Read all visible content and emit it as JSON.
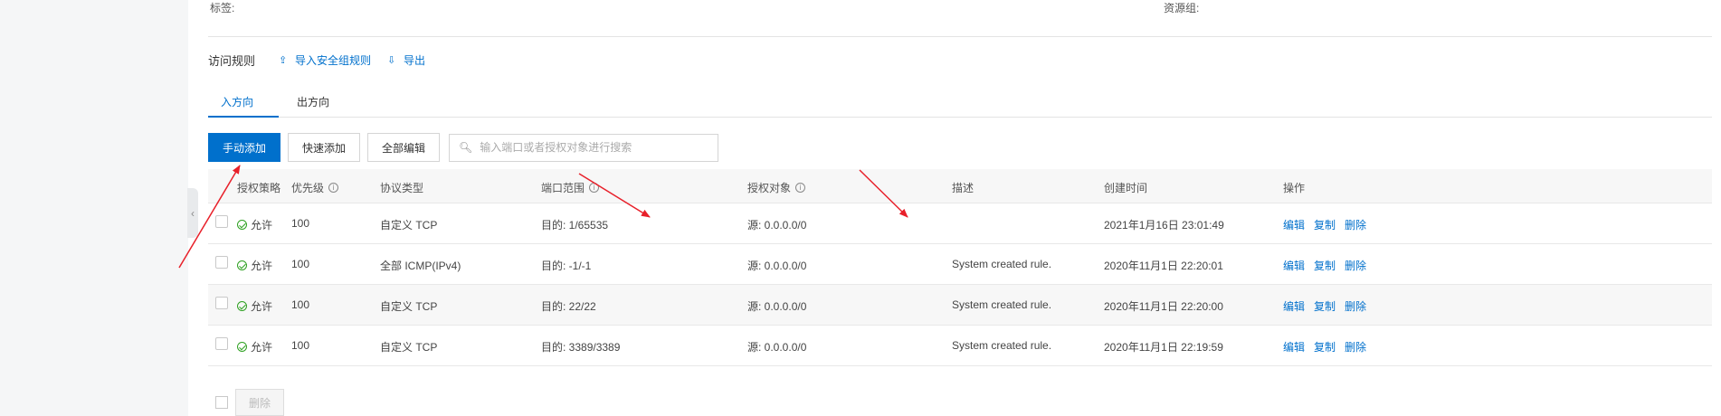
{
  "meta": {
    "tags_label": "标签:",
    "resource_group_label": "资源组:"
  },
  "rules": {
    "title": "访问规则",
    "import_label": "导入安全组规则",
    "export_label": "导出"
  },
  "tabs": [
    {
      "label": "入方向",
      "active": true
    },
    {
      "label": "出方向",
      "active": false
    }
  ],
  "toolbar": {
    "manual_add": "手动添加",
    "quick_add": "快速添加",
    "edit_all": "全部编辑",
    "search_placeholder": "输入端口或者授权对象进行搜索"
  },
  "table": {
    "columns": [
      "授权策略",
      "优先级",
      "协议类型",
      "端口范围",
      "授权对象",
      "描述",
      "创建时间",
      "操作"
    ],
    "rows": [
      {
        "policy": "允许",
        "priority": "100",
        "protocol": "自定义 TCP",
        "port": "目的: 1/65535",
        "object": "源: 0.0.0.0/0",
        "desc": "",
        "created": "2021年1月16日 23:01:49"
      },
      {
        "policy": "允许",
        "priority": "100",
        "protocol": "全部 ICMP(IPv4)",
        "port": "目的: -1/-1",
        "object": "源: 0.0.0.0/0",
        "desc": "System created rule.",
        "created": "2020年11月1日 22:20:01"
      },
      {
        "policy": "允许",
        "priority": "100",
        "protocol": "自定义 TCP",
        "port": "目的: 22/22",
        "object": "源: 0.0.0.0/0",
        "desc": "System created rule.",
        "created": "2020年11月1日 22:20:00"
      },
      {
        "policy": "允许",
        "priority": "100",
        "protocol": "自定义 TCP",
        "port": "目的: 3389/3389",
        "object": "源: 0.0.0.0/0",
        "desc": "System created rule.",
        "created": "2020年11月1日 22:19:59"
      }
    ],
    "row_actions": {
      "edit": "编辑",
      "copy": "复制",
      "delete": "删除"
    }
  },
  "footer": {
    "delete_label": "删除"
  },
  "colors": {
    "accent": "#0070cc",
    "allow_green": "#2ea121",
    "annotation_red": "#e8202a"
  }
}
